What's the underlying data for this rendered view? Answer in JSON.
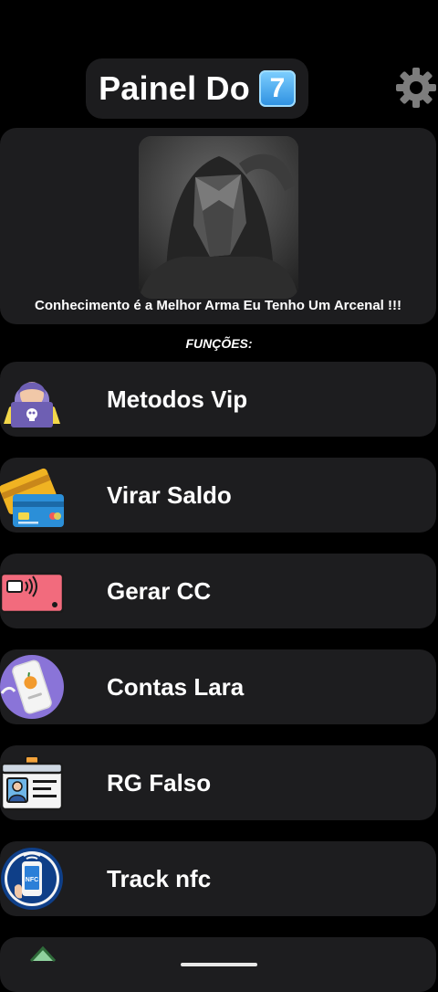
{
  "header": {
    "title": "Painel Do",
    "badge": "7",
    "badge_color": "#2c8fe0",
    "settings_icon": "gear-icon"
  },
  "hero": {
    "caption": "Conhecimento é a Melhor Arma Eu Tenho Um Arcenal !!!"
  },
  "section": {
    "label": "FUNÇÕES:"
  },
  "menu": {
    "items": [
      {
        "label": "Metodos Vip",
        "icon": "hacker-laptop-icon"
      },
      {
        "label": "Virar Saldo",
        "icon": "credit-cards-icon"
      },
      {
        "label": "Gerar CC",
        "icon": "contactless-card-icon"
      },
      {
        "label": "Contas Lara",
        "icon": "phone-app-icon"
      },
      {
        "label": "RG Falso",
        "icon": "id-card-icon"
      },
      {
        "label": "Track nfc",
        "icon": "nfc-phone-icon"
      }
    ]
  },
  "colors": {
    "background": "#000000",
    "card": "#1d1d1f",
    "text": "#ffffff"
  }
}
